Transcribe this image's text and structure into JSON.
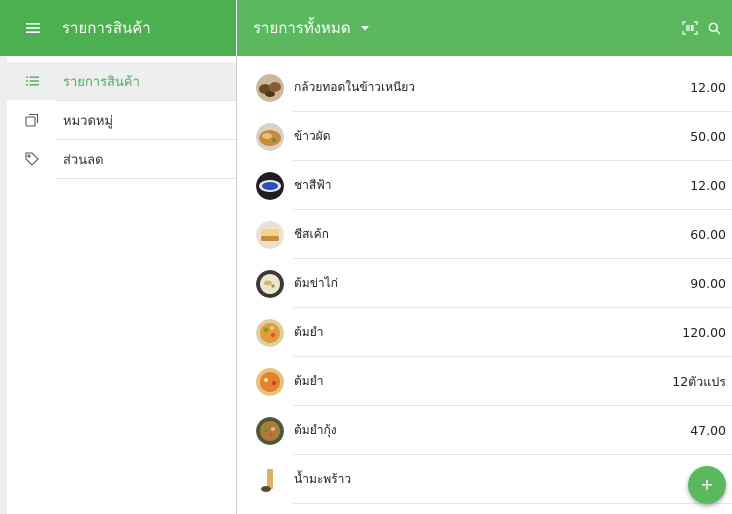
{
  "appbar": {
    "title": "รายการสินค้า",
    "list_title": "รายการทั้งหมด",
    "icons": [
      "menu-icon",
      "dropdown-icon",
      "barcode-scan-icon",
      "search-icon"
    ]
  },
  "sidebar": {
    "items": [
      {
        "label": "รายการสินค้า",
        "icon": "list-icon",
        "active": true
      },
      {
        "label": "หมวดหมู่",
        "icon": "category-icon",
        "active": false
      },
      {
        "label": "ส่วนลด",
        "icon": "tag-icon",
        "active": false
      }
    ]
  },
  "products": [
    {
      "name": "กล้วยทอดในข้าวเหนียว",
      "price": "12.00"
    },
    {
      "name": "ข้าวผัด",
      "price": "50.00"
    },
    {
      "name": "ชาสีฟ้า",
      "price": "12.00"
    },
    {
      "name": "ชีสเค้ก",
      "price": "60.00"
    },
    {
      "name": "ต้มข่าไก่",
      "price": "90.00"
    },
    {
      "name": "ต้มยำ",
      "price": "120.00"
    },
    {
      "name": "ต้มยำ",
      "price": "12ตัวแปร"
    },
    {
      "name": "ต้มยำกุ้ง",
      "price": "47.00"
    },
    {
      "name": "น้ำมะพร้าว",
      "price": ""
    }
  ],
  "fab": {
    "label": "+"
  },
  "colors": {
    "primary": "#4caf50",
    "appbar_right": "#5cb85f",
    "active_bg": "#eeeeee"
  }
}
